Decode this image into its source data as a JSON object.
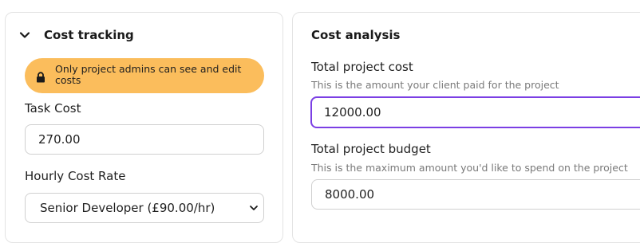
{
  "cost_tracking": {
    "title": "Cost tracking",
    "admin_notice": "Only project admins can see and edit costs",
    "task_cost": {
      "label": "Task Cost",
      "value": "270.00"
    },
    "hourly_rate": {
      "label": "Hourly Cost Rate",
      "selected": "Senior Developer (£90.00/hr)"
    }
  },
  "cost_analysis": {
    "title": "Cost analysis",
    "total_project_cost": {
      "label": "Total project cost",
      "help": "This is the amount your client paid for the project",
      "value": "12000.00"
    },
    "total_project_budget": {
      "label": "Total project budget",
      "help": "This is the maximum amount you'd like to spend on the project",
      "value": "8000.00"
    }
  },
  "colors": {
    "badge": "#fbbd5c",
    "focus_ring": "#7b3fe4"
  }
}
